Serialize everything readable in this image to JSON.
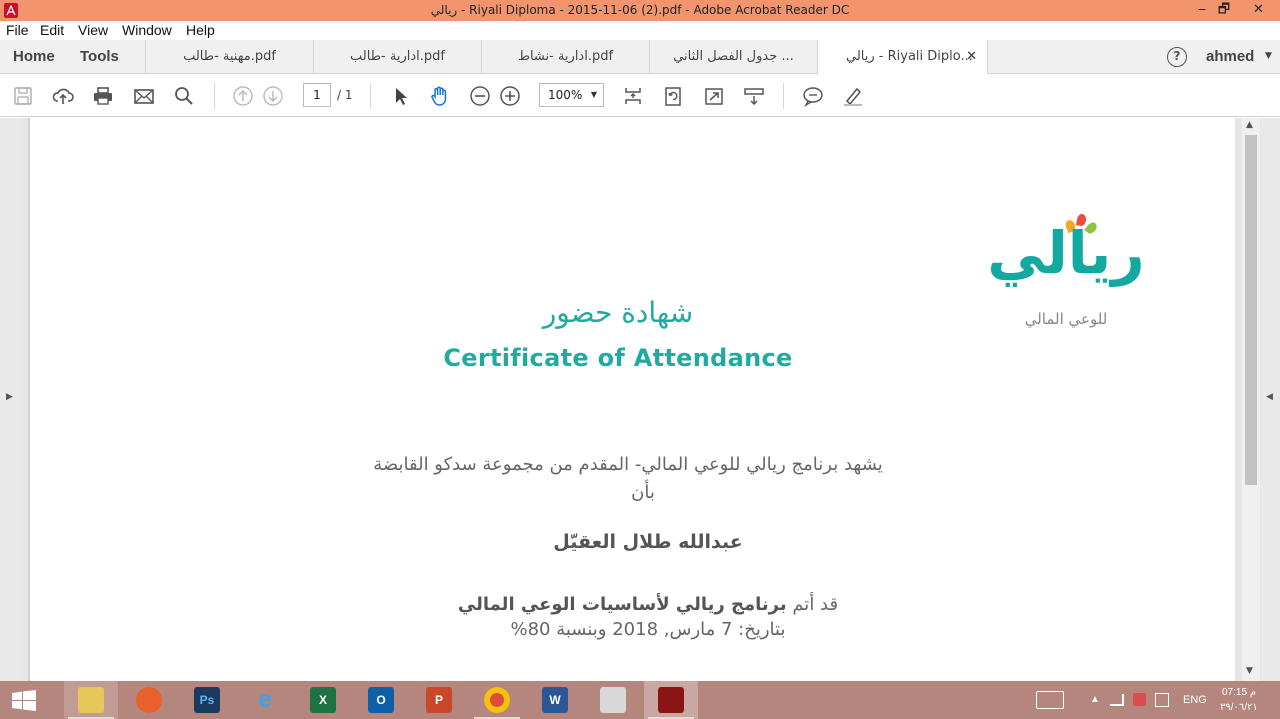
{
  "window": {
    "title": "ريالي - Riyali Diploma - 2015-11-06 (2).pdf - Adobe Acrobat Reader DC",
    "minimize": "‒",
    "maximize": "🗗",
    "close": "✕"
  },
  "menu": {
    "file": "File",
    "edit": "Edit",
    "view": "View",
    "window": "Window",
    "help": "Help"
  },
  "tabs": {
    "home": "Home",
    "tools": "Tools",
    "documents": [
      {
        "label": "مهنية -طالب.pdf"
      },
      {
        "label": "ادارية -طالب.pdf"
      },
      {
        "label": "ادارية -نشاط.pdf"
      },
      {
        "label": "جدول الفصل الثاني ..."
      },
      {
        "label": "ريالي - Riyali Diplo...",
        "active": true,
        "close": "✕"
      }
    ],
    "help_glyph": "?",
    "user": "ahmed",
    "user_caret": "▼"
  },
  "toolbar": {
    "page_current": "1",
    "page_total": "/  1",
    "zoom": "100%",
    "zoom_caret": "▼"
  },
  "document": {
    "logo_main": "ريالي",
    "logo_sub": "للوعي المالي",
    "cert_title_ar": "شهادة حضور",
    "cert_title_en": "Certificate of Attendance",
    "line1": "يشهد برنامج ريالي للوعي المالي- المقدم من مجموعة سدكو القابضة",
    "line2": "بأن",
    "recipient": "عبدالله طلال العقيّل",
    "line4_prefix": "قد أتم ",
    "line4_bold": "برنامج ريالي لأساسيات الوعي المالي",
    "line5": "بتاريخ: 7 مارس, 2018 وبنسبة 80%"
  },
  "panels": {
    "left_toggle": "▶",
    "right_toggle": "◀",
    "scroll_up": "▲",
    "scroll_down": "▼"
  },
  "taskbar": {
    "apps": [
      "Ps",
      "X",
      "O",
      "P",
      "W"
    ],
    "lang": "ENG",
    "time": "07:15 م",
    "date": "٣٩/٠٦/٢١",
    "tray_caret": "▲"
  },
  "colors": {
    "titlebar": "#f2956e",
    "brand_teal": "#14a9a0",
    "taskbar": "#b5867e"
  }
}
